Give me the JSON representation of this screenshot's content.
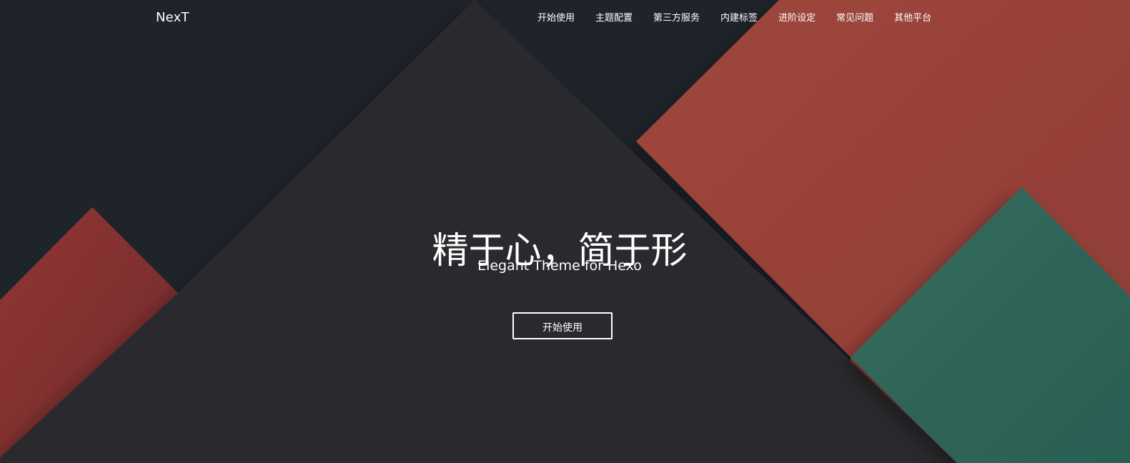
{
  "brand": {
    "name": "NexT"
  },
  "nav": {
    "items": [
      {
        "label": "开始使用"
      },
      {
        "label": "主题配置"
      },
      {
        "label": "第三方服务"
      },
      {
        "label": "内建标签"
      },
      {
        "label": "进阶设定"
      },
      {
        "label": "常见问题"
      },
      {
        "label": "其他平台"
      }
    ]
  },
  "hero": {
    "headline": "精于心，简于形",
    "subtitle": "Elegant Theme for Hexo",
    "cta_label": "开始使用"
  },
  "colors": {
    "background": "#1f242b",
    "dark_triangle": "#2a2b2e",
    "red": "#9c443b",
    "deep_red": "#8b3430",
    "green": "#31665a",
    "text": "#ffffff"
  }
}
